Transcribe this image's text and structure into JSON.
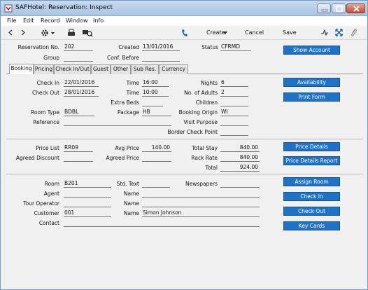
{
  "window": {
    "title": "SAFHotel: Reservation: Inspect"
  },
  "menu": [
    "File",
    "Edit",
    "Record",
    "Window",
    "Info"
  ],
  "toolbar": {
    "create": "Create",
    "cancel": "Cancel",
    "save": "Save"
  },
  "header": {
    "reservation_no_label": "Reservation No.",
    "reservation_no": "202",
    "created_label": "Created",
    "created": "13/01/2016",
    "status_label": "Status",
    "status": "CFRMD",
    "group_label": "Group",
    "group": "",
    "conf_before_label": "Conf. Before",
    "conf_before": "",
    "show_account": "Show Account"
  },
  "tabs": [
    "Booking",
    "Pricing",
    "Check In/Out",
    "Guest",
    "Other",
    "Sub Res.",
    "Currency"
  ],
  "booking": {
    "check_in_label": "Check In",
    "check_in": "22/01/2016",
    "time_in_label": "Time",
    "time_in": "16:00",
    "nights_label": "Nights",
    "nights": "6",
    "check_out_label": "Check Out",
    "check_out": "28/01/2016",
    "time_out_label": "Time",
    "time_out": "10:00",
    "adults_label": "No. of Adults",
    "adults": "2",
    "extra_beds_label": "Extra Beds",
    "extra_beds": "",
    "children_label": "Children",
    "children": "",
    "room_type_label": "Room Type",
    "room_type": "BDBL",
    "package_label": "Package",
    "package": "HB",
    "origin_label": "Booking Origin",
    "origin": "WI",
    "reference_label": "Reference",
    "reference": "",
    "visit_purpose_label": "Visit Purpose",
    "visit_purpose": "",
    "border_label": "Border Check Point",
    "border": "",
    "availability": "Availability",
    "print_form": "Print Form"
  },
  "pricing": {
    "price_list_label": "Price List",
    "price_list": "RR09",
    "avg_price_label": "Avg Price",
    "avg_price": "140.00",
    "total_stay_label": "Total Stay",
    "total_stay": "840.00",
    "agreed_discount_label": "Agreed Discount",
    "agreed_discount": "",
    "agreed_price_label": "Agreed Price",
    "agreed_price": "",
    "rack_rate_label": "Rack Rate",
    "rack_rate": "840.00",
    "total_label": "Total",
    "total": "924.00",
    "price_details": "Price Details",
    "price_details_report": "Price Details Report"
  },
  "guest": {
    "room_label": "Room",
    "room": "B201",
    "std_text_label": "Std. Text",
    "std_text": "",
    "newspapers_label": "Newspapers",
    "newspapers": "",
    "agent_label": "Agent",
    "agent": "",
    "agent_name_label": "Name",
    "agent_name": "",
    "tour_label": "Tour Operator",
    "tour": "",
    "tour_name_label": "Name",
    "tour_name": "",
    "customer_label": "Customer",
    "customer": "001",
    "customer_name_label": "Name",
    "customer_name": "Simon Johnson",
    "contact_label": "Contact",
    "contact": "",
    "assign_room": "Assign Room",
    "check_in_btn": "Check In",
    "check_out_btn": "Check Out",
    "key_cards": "Key Cards"
  }
}
